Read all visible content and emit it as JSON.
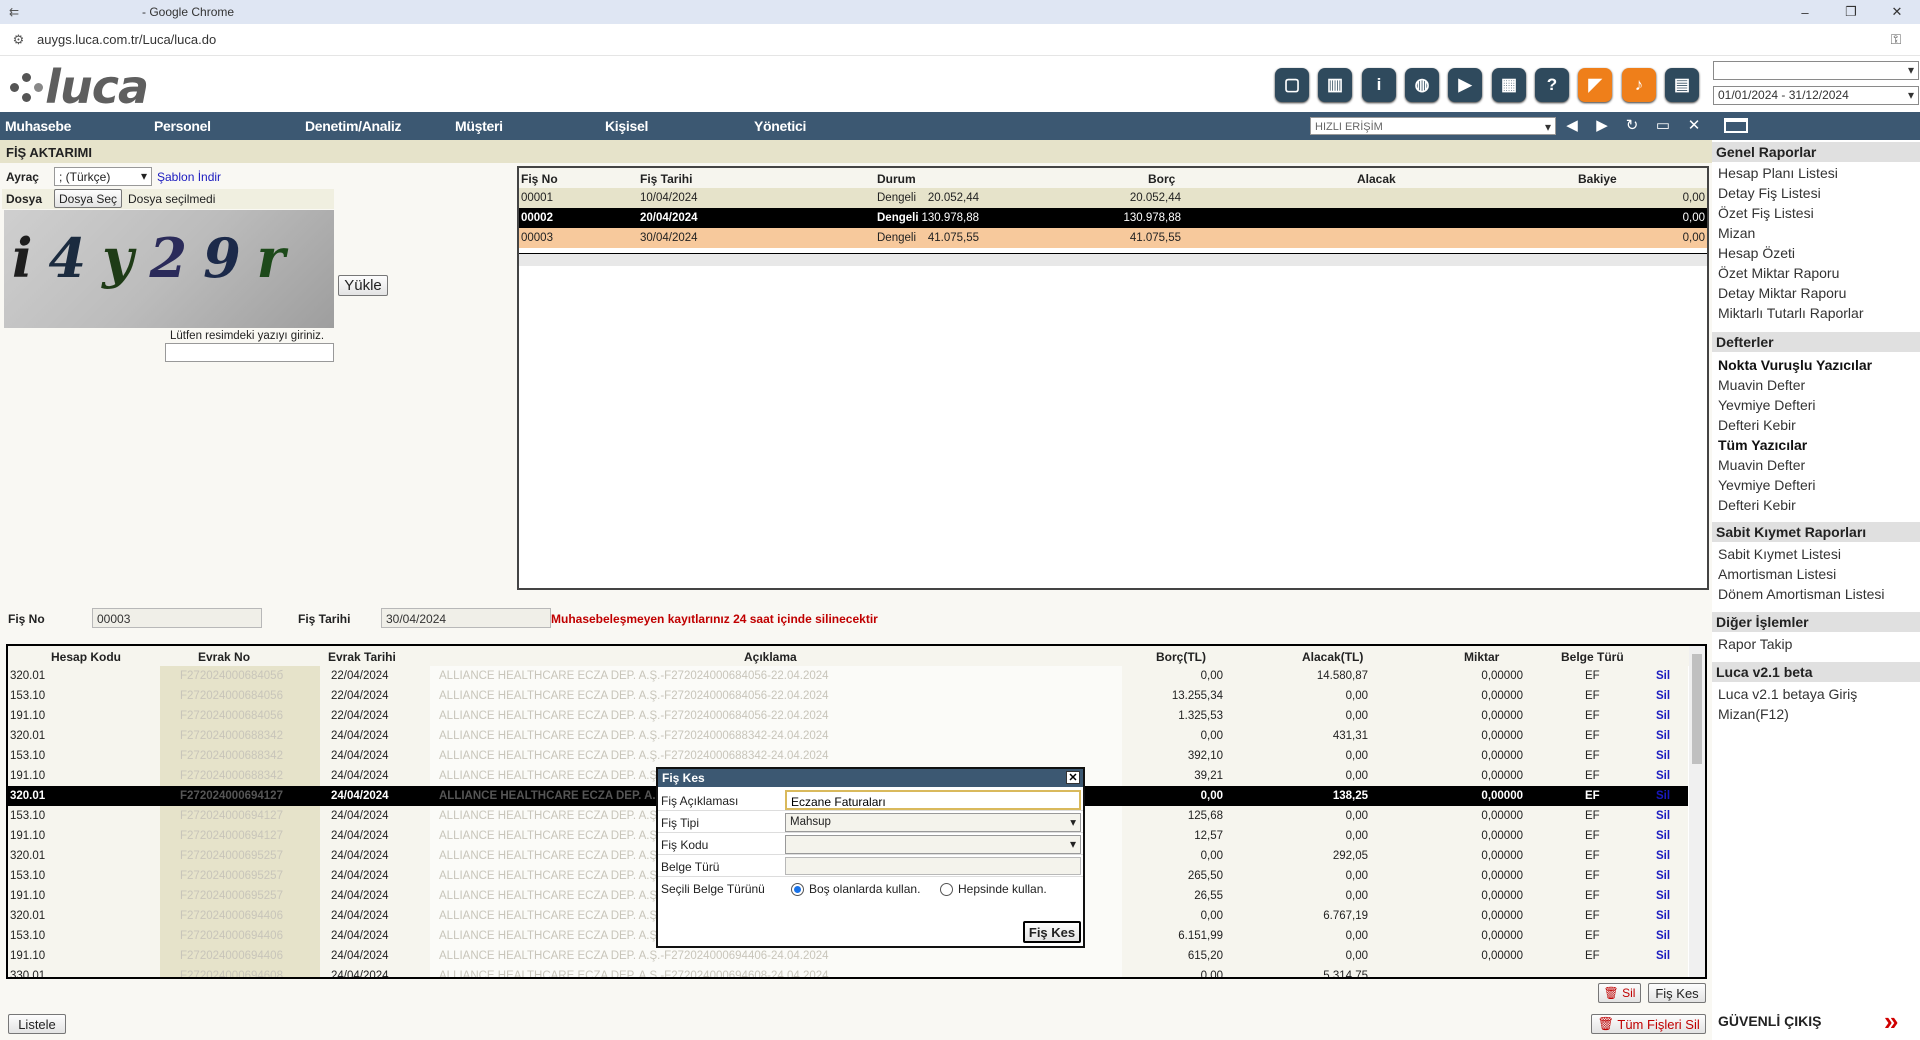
{
  "browser": {
    "title": "- Google Chrome",
    "url": "auygs.luca.com.tr/Luca/luca.do",
    "minimize": "–",
    "restore": "❐",
    "close": "✕"
  },
  "app": {
    "logo_text": "luca",
    "date_range": "01/01/2024 - 31/12/2024",
    "top_select": ""
  },
  "nav": {
    "items": [
      "Muhasebe",
      "Personel",
      "Denetim/Analiz",
      "Müşteri",
      "Kişisel",
      "Yönetici"
    ],
    "quick_access": "HIZLI ERİŞİM"
  },
  "page": {
    "section_title": "FİŞ AKTARIMI",
    "ayrac_label": "Ayraç",
    "ayrac_value": "; (Türkçe)",
    "sablon_link": "Şablon İndir",
    "dosya_label": "Dosya",
    "dosya_button": "Dosya Seç",
    "dosya_status": "Dosya seçilmedi",
    "captcha_text": "i4y29r",
    "captcha_prompt": "Lütfen resimdeki yazıyı giriniz.",
    "captcha_input": "",
    "upload_button": "Yükle",
    "fis_no_label": "Fiş No",
    "fis_no_value": "00003",
    "fis_tarihi_label": "Fiş Tarihi",
    "fis_tarihi_value": "30/04/2024",
    "warning": "Muhasebeleşmeyen kayıtlarınız 24 saat içinde silinecektir",
    "sil_button": "Sil",
    "fis_kes_button": "Fiş Kes",
    "listele_button": "Listele",
    "tum_sil_button": "Tüm Fişleri Sil"
  },
  "top_grid": {
    "headers": [
      "Fiş No",
      "Fiş Tarihi",
      "Durum",
      "Borç",
      "Alacak",
      "Bakiye"
    ],
    "rows": [
      [
        "00001",
        "10/04/2024",
        "Dengeli",
        "20.052,44",
        "20.052,44",
        "0,00"
      ],
      [
        "00002",
        "20/04/2024",
        "Dengeli",
        "130.978,88",
        "130.978,88",
        "0,00"
      ],
      [
        "00003",
        "30/04/2024",
        "Dengeli",
        "41.075,55",
        "41.075,55",
        "0,00"
      ]
    ]
  },
  "bottom_grid": {
    "headers": [
      "Hesap Kodu",
      "Evrak No",
      "Evrak Tarihi",
      "Açıklama",
      "Borç(TL)",
      "Alacak(TL)",
      "Miktar",
      "Belge Türü"
    ],
    "rows": [
      [
        "320.01",
        "F27202400068405б",
        "22/04/2024",
        "ALLIANCE HEALTHCARE ECZA DEP. A.Ş.-F272024000684056-22.04.2024",
        "0,00",
        "14.580,87",
        "0,00000",
        "EF",
        "Sil"
      ],
      [
        "153.10",
        "F272024000684056",
        "22/04/2024",
        "ALLIANCE HEALTHCARE ECZA DEP. A.Ş.-F272024000684056-22.04.2024",
        "13.255,34",
        "0,00",
        "0,00000",
        "EF",
        "Sil"
      ],
      [
        "191.10",
        "F272024000684056",
        "22/04/2024",
        "ALLIANCE HEALTHCARE ECZA DEP. A.Ş.-F272024000684056-22.04.2024",
        "1.325,53",
        "0,00",
        "0,00000",
        "EF",
        "Sil"
      ],
      [
        "320.01",
        "F272024000688342",
        "24/04/2024",
        "ALLIANCE HEALTHCARE ECZA DEP. A.Ş.-F272024000688342-24.04.2024",
        "0,00",
        "431,31",
        "0,00000",
        "EF",
        "Sil"
      ],
      [
        "153.10",
        "F272024000688342",
        "24/04/2024",
        "ALLIANCE HEALTHCARE ECZA DEP. A.Ş.-F272024000688342-24.04.2024",
        "392,10",
        "0,00",
        "0,00000",
        "EF",
        "Sil"
      ],
      [
        "191.10",
        "F272024000688342",
        "24/04/2024",
        "ALLIANCE HEALTHCARE ECZA DEP. A.Ş.-F272024000688342-24.04.2024",
        "39,21",
        "0,00",
        "0,00000",
        "EF",
        "Sil"
      ],
      [
        "320.01",
        "F272024000694127",
        "24/04/2024",
        "ALLIANCE HEALTHCARE ECZA DEP. A.Ş.-F272024000694127-24.04.2024",
        "0,00",
        "138,25",
        "0,00000",
        "EF",
        "Sil"
      ],
      [
        "153.10",
        "F272024000694127",
        "24/04/2024",
        "ALLIANCE HEALTHCARE ECZA DEP. A.Ş.-F272024000694127-24.04.2024",
        "125,68",
        "0,00",
        "0,00000",
        "EF",
        "Sil"
      ],
      [
        "191.10",
        "F272024000694127",
        "24/04/2024",
        "ALLIANCE HEALTHCARE ECZA DEP. A.Ş.-F272024000694127-24.04.2024",
        "12,57",
        "0,00",
        "0,00000",
        "EF",
        "Sil"
      ],
      [
        "320.01",
        "F272024000695257",
        "24/04/2024",
        "ALLIANCE HEALTHCARE ECZA DEP. A.Ş.-F272024000695257-24.04.2024",
        "0,00",
        "292,05",
        "0,00000",
        "EF",
        "Sil"
      ],
      [
        "153.10",
        "F272024000695257",
        "24/04/2024",
        "ALLIANCE HEALTHCARE ECZA DEP. A.Ş.-F272024000695257-24.04.2024",
        "265,50",
        "0,00",
        "0,00000",
        "EF",
        "Sil"
      ],
      [
        "191.10",
        "F272024000695257",
        "24/04/2024",
        "ALLIANCE HEALTHCARE ECZA DEP. A.Ş.-F272024000695257-24.04.2024",
        "26,55",
        "0,00",
        "0,00000",
        "EF",
        "Sil"
      ],
      [
        "320.01",
        "F272024000694406",
        "24/04/2024",
        "ALLIANCE HEALTHCARE ECZA DEP. A.Ş.-F272024000694406-24.04.2024",
        "0,00",
        "6.767,19",
        "0,00000",
        "EF",
        "Sil"
      ],
      [
        "153.10",
        "F272024000694406",
        "24/04/2024",
        "ALLIANCE HEALTHCARE ECZA DEP. A.Ş.-F272024000694406-24.04.2024",
        "6.151,99",
        "0,00",
        "0,00000",
        "EF",
        "Sil"
      ],
      [
        "191.10",
        "F272024000694406",
        "24/04/2024",
        "ALLIANCE HEALTHCARE ECZA DEP. A.Ş.-F272024000694406-24.04.2024",
        "615,20",
        "0,00",
        "0,00000",
        "EF",
        "Sil"
      ],
      [
        "330.01",
        "F272024000694608",
        "24/04/2024",
        "ALLIANCE HEALTHCARE ECZA DEP. A.Ş.-F272024000694608-24.04.2024",
        "0,00",
        "5.314,75",
        "",
        "",
        ""
      ]
    ]
  },
  "modal": {
    "title": "Fiş Kes",
    "close": "✕",
    "aciklama_label": "Fiş Açıklaması",
    "aciklama_value": "Eczane Faturaları",
    "tipi_label": "Fiş Tipi",
    "tipi_value": "Mahsup",
    "kodu_label": "Fiş Kodu",
    "kodu_value": "",
    "belge_label": "Belge Türü",
    "belge_value": "",
    "secili_label": "Seçili Belge Türünü",
    "opt1": "Boş olanlarda kullan.",
    "opt2": "Hepsinde kullan.",
    "submit": "Fiş Kes"
  },
  "sidebar": {
    "genel": "Genel Raporlar",
    "genel_items": [
      "Hesap Planı Listesi",
      "Detay Fiş Listesi",
      "Özet Fiş Listesi",
      "Mizan",
      "Hesap Özeti",
      "Özet Miktar Raporu",
      "Detay Miktar Raporu",
      "Miktarlı Tutarlı Raporlar"
    ],
    "defterler": "Defterler",
    "nokta": "Nokta Vuruşlu Yazıcılar",
    "nokta_items": [
      "Muavin Defter",
      "Yevmiye Defteri",
      "Defteri Kebir"
    ],
    "tum": "Tüm Yazıcılar",
    "tum_items": [
      "Muavin Defter",
      "Yevmiye Defteri",
      "Defteri Kebir"
    ],
    "sabit": "Sabit Kıymet Raporları",
    "sabit_items": [
      "Sabit Kıymet Listesi",
      "Amortisman Listesi",
      "Dönem Amortisman Listesi"
    ],
    "diger": "Diğer İşlemler",
    "diger_items": [
      "Rapor Takip"
    ],
    "luca": "Luca v2.1 beta",
    "luca_items": [
      "Luca v2.1 betaya Giriş",
      "Mizan(F12)"
    ],
    "logout": "GÜVENLİ ÇIKIŞ"
  }
}
